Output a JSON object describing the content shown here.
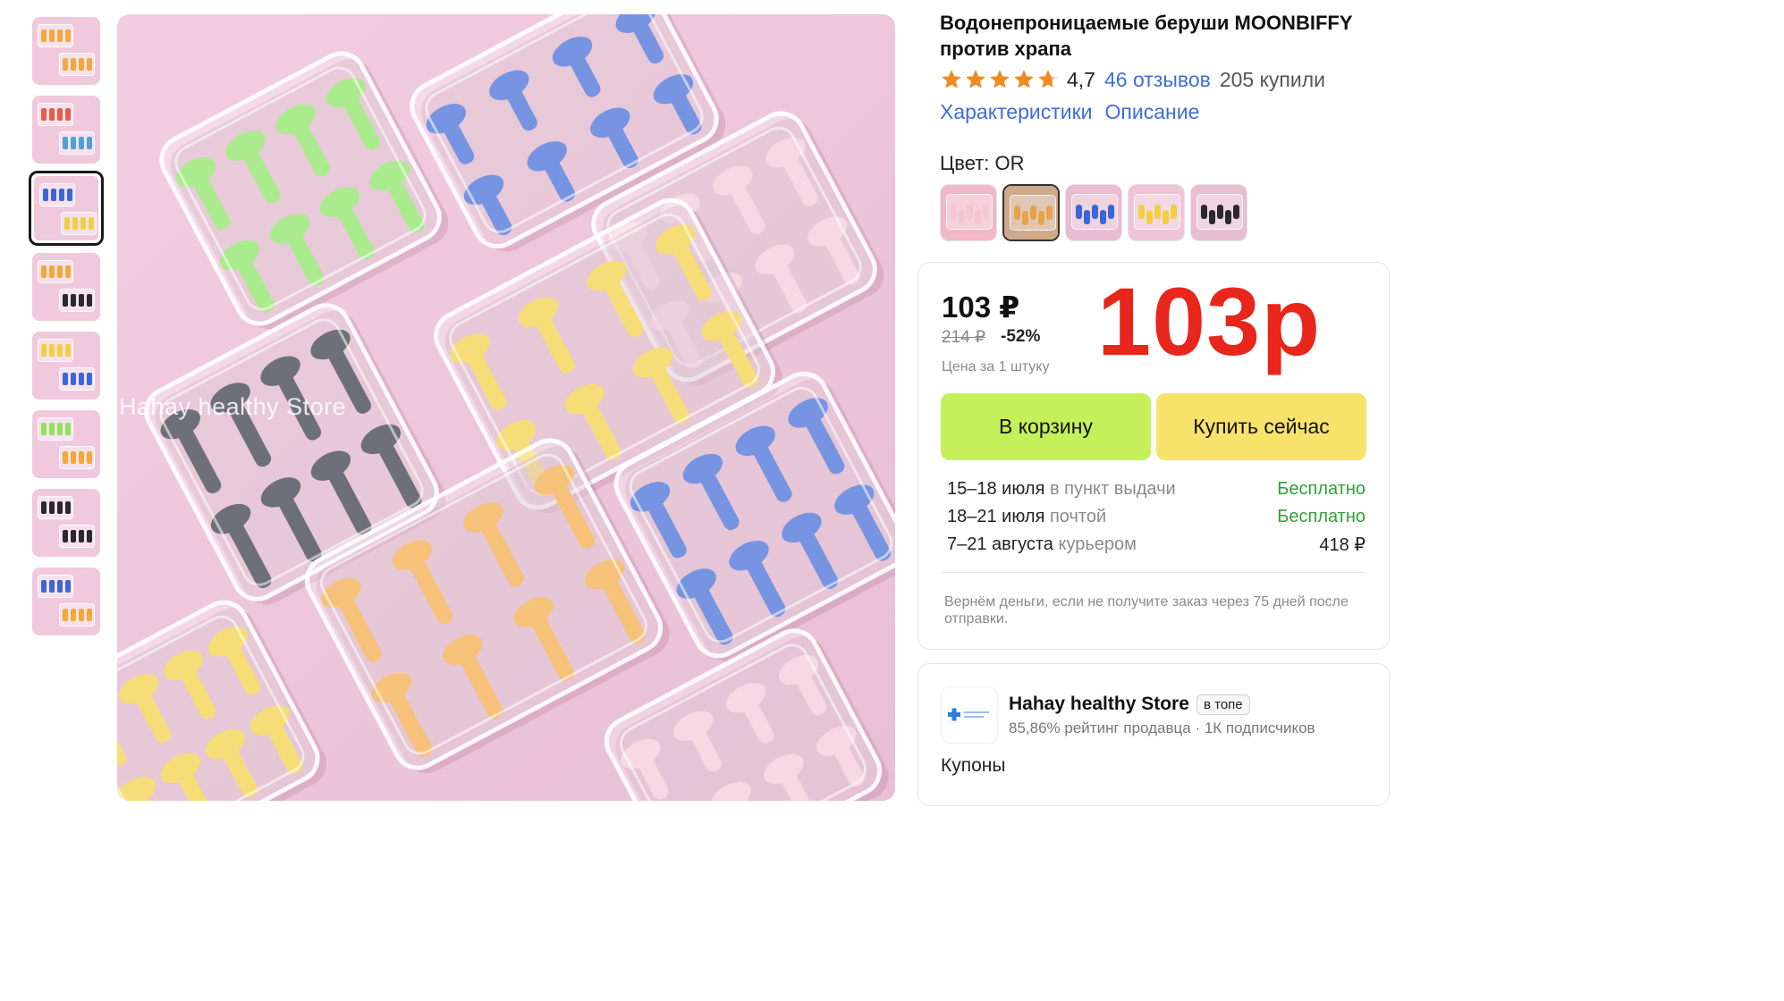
{
  "product": {
    "title": "Водонепроницаемые беруши MOONBIFFY против храпа",
    "rating": "4,7",
    "rating_stars": 4.7,
    "reviews_link": "46 отзывов",
    "sold": "205 купили",
    "tabs": [
      "Характеристики",
      "Описание"
    ],
    "color_label": "Цвет: OR",
    "swatches": [
      {
        "color": "#f2b8c8",
        "plugs": "#f4c6d4",
        "selected": false
      },
      {
        "color": "#cfa98a",
        "plugs": "#e8a24a",
        "selected": true
      },
      {
        "color": "#e9bcd2",
        "plugs": "#3b66d6",
        "selected": false
      },
      {
        "color": "#efc4d6",
        "plugs": "#f2cf3e",
        "selected": false
      },
      {
        "color": "#e8bfd1",
        "plugs": "#2a2a2e",
        "selected": false
      }
    ],
    "watermark": "Hahay healthy Store"
  },
  "price": {
    "current": "103 ₽",
    "old": "214 ₽",
    "discount": "-52%",
    "per_unit": "Цена за 1 штуку",
    "overlay": "103р",
    "cart_button": "В корзину",
    "buy_button": "Купить сейчас"
  },
  "delivery": [
    {
      "date": "15–18 июля",
      "method": "в пункт выдачи",
      "cost": "Бесплатно",
      "free": true
    },
    {
      "date": "18–21 июля",
      "method": "почтой",
      "cost": "Бесплатно",
      "free": true
    },
    {
      "date": "7–21 августа",
      "method": "курьером",
      "cost": "418 ₽",
      "free": false
    }
  ],
  "refund_note": "Вернём деньги, если не получите заказ через 75 дней после отправки.",
  "store": {
    "name": "Hahay healthy Store",
    "badge": "в топе",
    "meta": "85,86% рейтинг продавца · 1К подписчиков",
    "coupons": "Купоны"
  },
  "colors": {
    "accent_link": "#3d6ed8",
    "price_red": "#e8261c",
    "cart_green": "#c6f05a",
    "buy_yellow": "#f7e36a",
    "free_green": "#2fa038",
    "star": "#f08a24"
  },
  "thumbnails": [
    {
      "plugs": [
        "#f2a93a",
        "#f2a93a"
      ],
      "selected": false
    },
    {
      "plugs": [
        "#e85a4a",
        "#4aa3d8"
      ],
      "selected": false
    },
    {
      "plugs": [
        "#3b66d6",
        "#f2cf3e"
      ],
      "selected": true
    },
    {
      "plugs": [
        "#f2a93a",
        "#2a2a2e"
      ],
      "selected": false
    },
    {
      "plugs": [
        "#f2cf3e",
        "#3b66d6"
      ],
      "selected": false
    },
    {
      "plugs": [
        "#8fe25a",
        "#f2a93a"
      ],
      "selected": false
    },
    {
      "plugs": [
        "#2a2a2e",
        "#2a2a2e"
      ],
      "selected": false
    },
    {
      "plugs": [
        "#3b66d6",
        "#f2a93a"
      ],
      "selected": false
    }
  ]
}
